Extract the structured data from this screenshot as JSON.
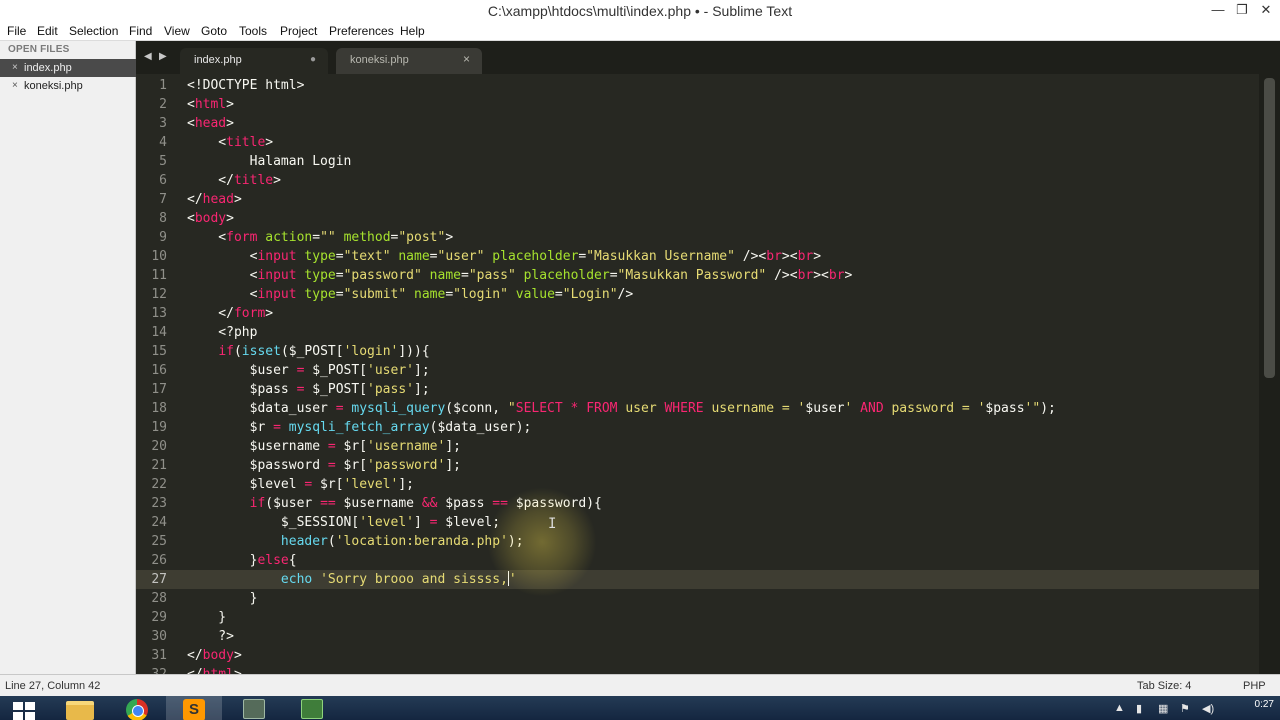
{
  "window": {
    "title": "C:\\xampp\\htdocs\\multi\\index.php • - Sublime Text",
    "minimize": "—",
    "maximize": "❐",
    "close": "✕"
  },
  "menu": [
    "File",
    "Edit",
    "Selection",
    "Find",
    "View",
    "Goto",
    "Tools",
    "Project",
    "Preferences",
    "Help"
  ],
  "sidebar": {
    "header": "OPEN FILES",
    "files": [
      {
        "name": "index.php",
        "close": "×",
        "active": true
      },
      {
        "name": "koneksi.php",
        "close": "×",
        "active": false
      }
    ]
  },
  "tabs": {
    "nav_left": "◀",
    "nav_right": "▶",
    "items": [
      {
        "name": "index.php",
        "control": "●",
        "active": true,
        "modified": true
      },
      {
        "name": "koneksi.php",
        "control": "×",
        "active": false
      }
    ]
  },
  "editor": {
    "current_line": 27,
    "lines": [
      {
        "n": "1",
        "tokens": [
          [
            "pl",
            "<!DOCTYPE html>"
          ]
        ]
      },
      {
        "n": "2",
        "tokens": [
          [
            "pl",
            "<"
          ],
          [
            "tg",
            "html"
          ],
          [
            "pl",
            ">"
          ]
        ]
      },
      {
        "n": "3",
        "tokens": [
          [
            "pl",
            "<"
          ],
          [
            "tg",
            "head"
          ],
          [
            "pl",
            ">"
          ]
        ]
      },
      {
        "n": "4",
        "tokens": [
          [
            "pl",
            "    <"
          ],
          [
            "tg",
            "title"
          ],
          [
            "pl",
            ">"
          ]
        ]
      },
      {
        "n": "5",
        "tokens": [
          [
            "pl",
            "        Halaman Login"
          ]
        ]
      },
      {
        "n": "6",
        "tokens": [
          [
            "pl",
            "    </"
          ],
          [
            "tg",
            "title"
          ],
          [
            "pl",
            ">"
          ]
        ]
      },
      {
        "n": "7",
        "tokens": [
          [
            "pl",
            "</"
          ],
          [
            "tg",
            "head"
          ],
          [
            "pl",
            ">"
          ]
        ]
      },
      {
        "n": "8",
        "tokens": [
          [
            "pl",
            "<"
          ],
          [
            "tg",
            "body"
          ],
          [
            "pl",
            ">"
          ]
        ]
      },
      {
        "n": "9",
        "tokens": [
          [
            "pl",
            "    <"
          ],
          [
            "tg",
            "form"
          ],
          [
            "pl",
            " "
          ],
          [
            "at",
            "action"
          ],
          [
            "pl",
            "="
          ],
          [
            "st",
            "\"\""
          ],
          [
            "pl",
            " "
          ],
          [
            "at",
            "method"
          ],
          [
            "pl",
            "="
          ],
          [
            "st",
            "\"post\""
          ],
          [
            "pl",
            ">"
          ]
        ]
      },
      {
        "n": "10",
        "tokens": [
          [
            "pl",
            "        <"
          ],
          [
            "tg",
            "input"
          ],
          [
            "pl",
            " "
          ],
          [
            "at",
            "type"
          ],
          [
            "pl",
            "="
          ],
          [
            "st",
            "\"text\""
          ],
          [
            "pl",
            " "
          ],
          [
            "at",
            "name"
          ],
          [
            "pl",
            "="
          ],
          [
            "st",
            "\"user\""
          ],
          [
            "pl",
            " "
          ],
          [
            "at",
            "placeholder"
          ],
          [
            "pl",
            "="
          ],
          [
            "st",
            "\"Masukkan Username\""
          ],
          [
            "pl",
            " /><"
          ],
          [
            "tg",
            "br"
          ],
          [
            "pl",
            "><"
          ],
          [
            "tg",
            "br"
          ],
          [
            "pl",
            ">"
          ]
        ]
      },
      {
        "n": "11",
        "tokens": [
          [
            "pl",
            "        <"
          ],
          [
            "tg",
            "input"
          ],
          [
            "pl",
            " "
          ],
          [
            "at",
            "type"
          ],
          [
            "pl",
            "="
          ],
          [
            "st",
            "\"password\""
          ],
          [
            "pl",
            " "
          ],
          [
            "at",
            "name"
          ],
          [
            "pl",
            "="
          ],
          [
            "st",
            "\"pass\""
          ],
          [
            "pl",
            " "
          ],
          [
            "at",
            "placeholder"
          ],
          [
            "pl",
            "="
          ],
          [
            "st",
            "\"Masukkan Password\""
          ],
          [
            "pl",
            " /><"
          ],
          [
            "tg",
            "br"
          ],
          [
            "pl",
            "><"
          ],
          [
            "tg",
            "br"
          ],
          [
            "pl",
            ">"
          ]
        ]
      },
      {
        "n": "12",
        "tokens": [
          [
            "pl",
            "        <"
          ],
          [
            "tg",
            "input"
          ],
          [
            "pl",
            " "
          ],
          [
            "at",
            "type"
          ],
          [
            "pl",
            "="
          ],
          [
            "st",
            "\"submit\""
          ],
          [
            "pl",
            " "
          ],
          [
            "at",
            "name"
          ],
          [
            "pl",
            "="
          ],
          [
            "st",
            "\"login\""
          ],
          [
            "pl",
            " "
          ],
          [
            "at",
            "value"
          ],
          [
            "pl",
            "="
          ],
          [
            "st",
            "\"Login\""
          ],
          [
            "pl",
            "/>"
          ]
        ]
      },
      {
        "n": "13",
        "tokens": [
          [
            "pl",
            "    </"
          ],
          [
            "tg",
            "form"
          ],
          [
            "pl",
            ">"
          ]
        ]
      },
      {
        "n": "14",
        "tokens": [
          [
            "pl",
            "    <?php"
          ]
        ]
      },
      {
        "n": "15",
        "tokens": [
          [
            "pl",
            "    "
          ],
          [
            "kw",
            "if"
          ],
          [
            "pl",
            "("
          ],
          [
            "fn",
            "isset"
          ],
          [
            "pl",
            "($_POST["
          ],
          [
            "st",
            "'login'"
          ],
          [
            "pl",
            "])){"
          ]
        ]
      },
      {
        "n": "16",
        "tokens": [
          [
            "pl",
            "        $user "
          ],
          [
            "op",
            "="
          ],
          [
            "pl",
            " $_POST["
          ],
          [
            "st",
            "'user'"
          ],
          [
            "pl",
            "];"
          ]
        ]
      },
      {
        "n": "17",
        "tokens": [
          [
            "pl",
            "        $pass "
          ],
          [
            "op",
            "="
          ],
          [
            "pl",
            " $_POST["
          ],
          [
            "st",
            "'pass'"
          ],
          [
            "pl",
            "];"
          ]
        ]
      },
      {
        "n": "18",
        "tokens": [
          [
            "pl",
            "        $data_user "
          ],
          [
            "op",
            "="
          ],
          [
            "pl",
            " "
          ],
          [
            "fn",
            "mysqli_query"
          ],
          [
            "pl",
            "($conn, "
          ],
          [
            "st",
            "\""
          ],
          [
            "kw",
            "SELECT"
          ],
          [
            "st",
            " "
          ],
          [
            "kw",
            "*"
          ],
          [
            "st",
            " "
          ],
          [
            "kw",
            "FROM"
          ],
          [
            "st",
            " user "
          ],
          [
            "kw",
            "WHERE"
          ],
          [
            "st",
            " username = '"
          ],
          [
            "pl",
            "$user"
          ],
          [
            "st",
            "' "
          ],
          [
            "kw",
            "AND"
          ],
          [
            "st",
            " password = '"
          ],
          [
            "pl",
            "$pass"
          ],
          [
            "st",
            "'\""
          ],
          [
            "pl",
            ");"
          ]
        ]
      },
      {
        "n": "19",
        "tokens": [
          [
            "pl",
            "        $r "
          ],
          [
            "op",
            "="
          ],
          [
            "pl",
            " "
          ],
          [
            "fn",
            "mysqli_fetch_array"
          ],
          [
            "pl",
            "($data_user);"
          ]
        ]
      },
      {
        "n": "20",
        "tokens": [
          [
            "pl",
            "        $username "
          ],
          [
            "op",
            "="
          ],
          [
            "pl",
            " $r["
          ],
          [
            "st",
            "'username'"
          ],
          [
            "pl",
            "];"
          ]
        ]
      },
      {
        "n": "21",
        "tokens": [
          [
            "pl",
            "        $password "
          ],
          [
            "op",
            "="
          ],
          [
            "pl",
            " $r["
          ],
          [
            "st",
            "'password'"
          ],
          [
            "pl",
            "];"
          ]
        ]
      },
      {
        "n": "22",
        "tokens": [
          [
            "pl",
            "        $level "
          ],
          [
            "op",
            "="
          ],
          [
            "pl",
            " $r["
          ],
          [
            "st",
            "'level'"
          ],
          [
            "pl",
            "];"
          ]
        ]
      },
      {
        "n": "23",
        "tokens": [
          [
            "pl",
            "        "
          ],
          [
            "kw",
            "if"
          ],
          [
            "pl",
            "($user "
          ],
          [
            "op",
            "=="
          ],
          [
            "pl",
            " $username "
          ],
          [
            "op",
            "&&"
          ],
          [
            "pl",
            " $pass "
          ],
          [
            "op",
            "=="
          ],
          [
            "pl",
            " $password){"
          ]
        ]
      },
      {
        "n": "24",
        "tokens": [
          [
            "pl",
            "            $_SESSION["
          ],
          [
            "st",
            "'level'"
          ],
          [
            "pl",
            "] "
          ],
          [
            "op",
            "="
          ],
          [
            "pl",
            " $level;"
          ]
        ]
      },
      {
        "n": "25",
        "tokens": [
          [
            "pl",
            "            "
          ],
          [
            "fn",
            "header"
          ],
          [
            "pl",
            "("
          ],
          [
            "st",
            "'location:beranda.php'"
          ],
          [
            "pl",
            ");"
          ]
        ]
      },
      {
        "n": "26",
        "tokens": [
          [
            "pl",
            "        }"
          ],
          [
            "kw",
            "else"
          ],
          [
            "pl",
            "{"
          ]
        ]
      },
      {
        "n": "27",
        "tokens": [
          [
            "pl",
            "            "
          ],
          [
            "fn",
            "echo"
          ],
          [
            "pl",
            " "
          ],
          [
            "st",
            "'Sorry brooo and sissss,"
          ],
          [
            "caret",
            ""
          ],
          [
            "st",
            "'"
          ]
        ]
      },
      {
        "n": "28",
        "tokens": [
          [
            "pl",
            "        }"
          ]
        ]
      },
      {
        "n": "29",
        "tokens": [
          [
            "pl",
            "    }"
          ]
        ]
      },
      {
        "n": "30",
        "tokens": [
          [
            "pl",
            "    ?>"
          ]
        ]
      },
      {
        "n": "31",
        "tokens": [
          [
            "pl",
            "</"
          ],
          [
            "tg",
            "body"
          ],
          [
            "pl",
            ">"
          ]
        ]
      },
      {
        "n": "32",
        "tokens": [
          [
            "pl",
            "</"
          ],
          [
            "tg",
            "html"
          ],
          [
            "pl",
            ">"
          ]
        ]
      }
    ]
  },
  "status": {
    "position": "Line 27, Column 42",
    "tab_size": "Tab Size: 4",
    "syntax": "PHP"
  },
  "taskbar": {
    "apps": [
      {
        "name": "windows-explorer"
      },
      {
        "name": "google-chrome"
      },
      {
        "name": "sublime-text",
        "label": "S",
        "active": true
      },
      {
        "name": "app-4"
      },
      {
        "name": "app-5"
      }
    ],
    "tray_icons": [
      "▲",
      "▮",
      "▦",
      "⚑",
      "◀)"
    ],
    "time": "0:27"
  }
}
